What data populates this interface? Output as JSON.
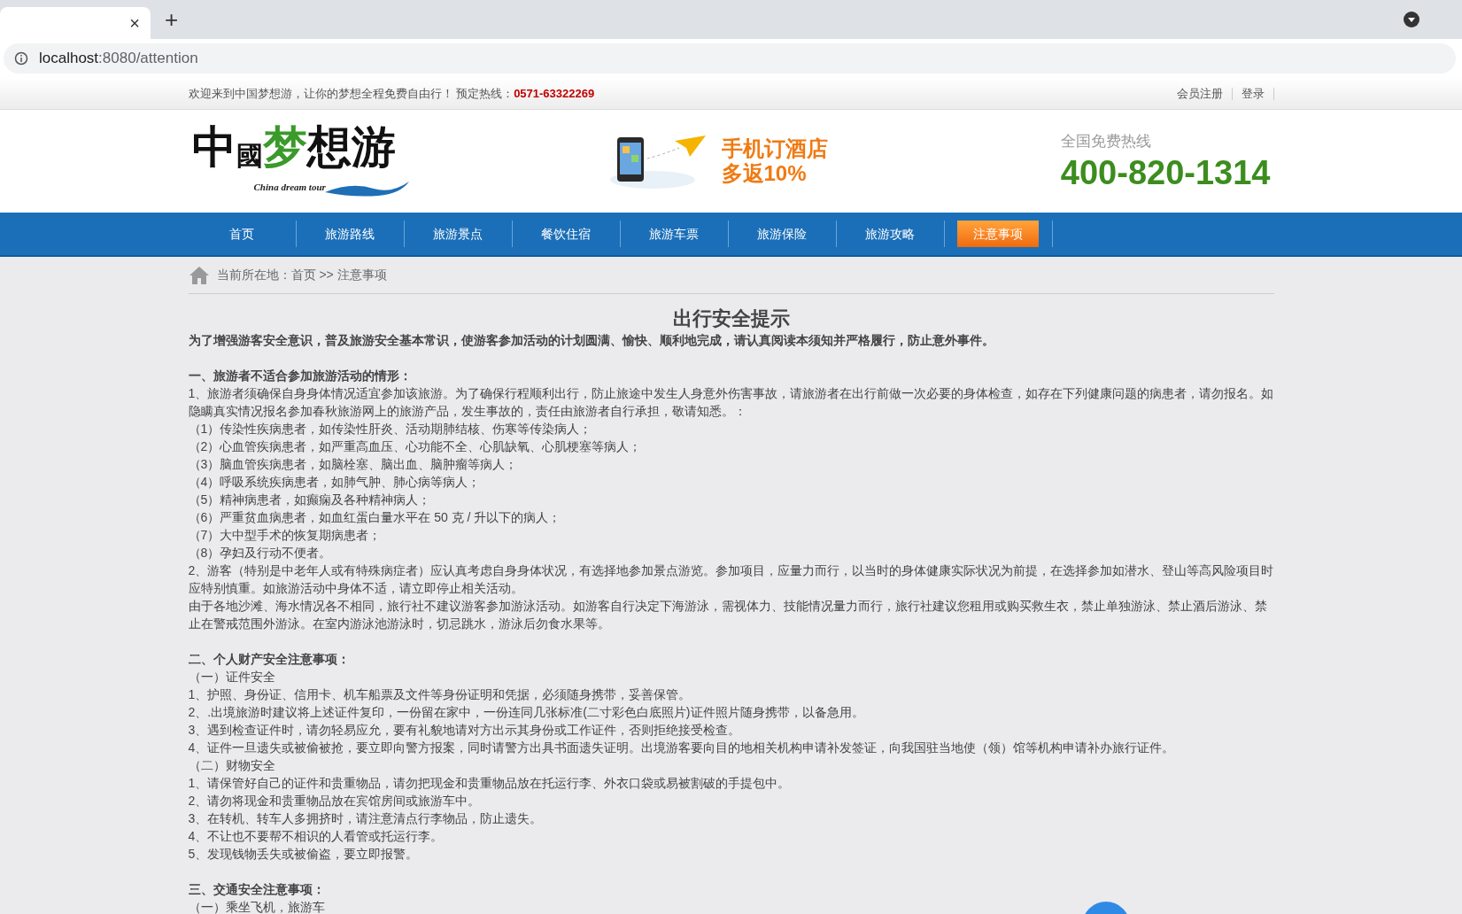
{
  "browser": {
    "tab_close": "×",
    "new_tab": "+",
    "url_host": "localhost",
    "url_rest": ":8080/attention"
  },
  "topbar": {
    "welcome": "欢迎来到中国梦想游，让你的梦想全程免费自由行！ 预定热线：",
    "hotline": "0571-63322269",
    "links": [
      "会员注册",
      "登录"
    ]
  },
  "header": {
    "logo_chars": [
      "中",
      "國",
      "梦",
      "想",
      "游"
    ],
    "logo_sub": "China dream tour",
    "ad_lines": [
      "手机订酒店",
      "多返10%"
    ],
    "hotline_label": "全国免费热线",
    "hotline": "400-820-1314"
  },
  "nav": [
    {
      "label": "首页",
      "selected": false
    },
    {
      "label": "旅游路线",
      "selected": false
    },
    {
      "label": "旅游景点",
      "selected": false
    },
    {
      "label": "餐饮住宿",
      "selected": false
    },
    {
      "label": "旅游车票",
      "selected": false
    },
    {
      "label": "旅游保险",
      "selected": false
    },
    {
      "label": "旅游攻略",
      "selected": false
    },
    {
      "label": "注意事项",
      "selected": true
    }
  ],
  "breadcrumb": "当前所在地：首页 >> 注意事项",
  "article": {
    "title": "出行安全提示",
    "paragraphs": [
      {
        "kind": "lead",
        "text": "为了增强游客安全意识，普及旅游安全基本常识，使游客参加活动的计划圆满、愉快、顺利地完成，请认真阅读本须知并严格履行，防止意外事件。"
      },
      {
        "kind": "heading",
        "text": "一、旅游者不适合参加旅游活动的情形："
      },
      {
        "kind": "text",
        "text": "1、旅游者须确保自身身体情况适宜参加该旅游。为了确保行程顺利出行，防止旅途中发生人身意外伤害事故，请旅游者在出行前做一次必要的身体检查，如存在下列健康问题的病患者，请勿报名。如隐瞒真实情况报名参加春秋旅游网上的旅游产品，发生事故的，责任由旅游者自行承担，敬请知悉。："
      },
      {
        "kind": "text",
        "text": "（1）传染性疾病患者，如传染性肝炎、活动期肺结核、伤寒等传染病人；"
      },
      {
        "kind": "text",
        "text": "（2）心血管疾病患者，如严重高血压、心功能不全、心肌缺氧、心肌梗塞等病人；"
      },
      {
        "kind": "text",
        "text": "（3）脑血管疾病患者，如脑栓塞、脑出血、脑肿瘤等病人；"
      },
      {
        "kind": "text",
        "text": "（4）呼吸系统疾病患者，如肺气肿、肺心病等病人；"
      },
      {
        "kind": "text",
        "text": "（5）精神病患者，如癫痫及各种精神病人；"
      },
      {
        "kind": "text",
        "text": "（6）严重贫血病患者，如血红蛋白量水平在 50 克 / 升以下的病人；"
      },
      {
        "kind": "text",
        "text": "（7）大中型手术的恢复期病患者；"
      },
      {
        "kind": "text",
        "text": "（8）孕妇及行动不便者。"
      },
      {
        "kind": "text",
        "text": "2、游客（特别是中老年人或有特殊病症者）应认真考虑自身身体状况，有选择地参加景点游览。参加项目，应量力而行，以当时的身体健康实际状况为前提，在选择参加如潜水、登山等高风险项目时应特别慎重。如旅游活动中身体不适，请立即停止相关活动。"
      },
      {
        "kind": "text",
        "text": "由于各地沙滩、海水情况各不相同，旅行社不建议游客参加游泳活动。如游客自行决定下海游泳，需视体力、技能情况量力而行，旅行社建议您租用或购买救生衣，禁止单独游泳、禁止酒后游泳、禁止在警戒范围外游泳。在室内游泳池游泳时，切忌跳水，游泳后勿食水果等。"
      },
      {
        "kind": "heading",
        "text": "二、个人财产安全注意事项："
      },
      {
        "kind": "text",
        "text": "（一）证件安全"
      },
      {
        "kind": "text",
        "text": "1、护照、身份证、信用卡、机车船票及文件等身份证明和凭据，必须随身携带，妥善保管。"
      },
      {
        "kind": "text",
        "text": "2、.出境旅游时建议将上述证件复印，一份留在家中，一份连同几张标准(二寸彩色白底照片)证件照片随身携带，以备急用。"
      },
      {
        "kind": "text",
        "text": "3、遇到检查证件时，请勿轻易应允，要有礼貌地请对方出示其身份或工作证件，否则拒绝接受检查。"
      },
      {
        "kind": "text",
        "text": "4、证件一旦遗失或被偷被抢，要立即向警方报案，同时请警方出具书面遗失证明。出境游客要向目的地相关机构申请补发签证，向我国驻当地使（领）馆等机构申请补办旅行证件。"
      },
      {
        "kind": "text",
        "text": "（二）财物安全"
      },
      {
        "kind": "text",
        "text": "1、请保管好自己的证件和贵重物品，请勿把现金和贵重物品放在托运行李、外衣口袋或易被割破的手提包中。"
      },
      {
        "kind": "text",
        "text": "2、请勿将现金和贵重物品放在宾馆房间或旅游车中。"
      },
      {
        "kind": "text",
        "text": "3、在转机、转车人多拥挤时，请注意清点行李物品，防止遗失。"
      },
      {
        "kind": "text",
        "text": "4、不让也不要帮不相识的人看管或托运行李。"
      },
      {
        "kind": "text",
        "text": "5、发现钱物丢失或被偷盗，要立即报警。"
      },
      {
        "kind": "heading",
        "text": "三、交通安全注意事项："
      },
      {
        "kind": "text",
        "text": "（一）乘坐飞机，旅游车"
      }
    ]
  }
}
